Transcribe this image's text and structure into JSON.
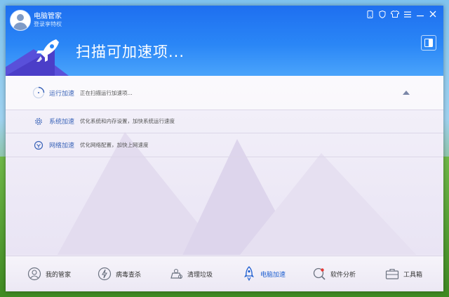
{
  "window": {
    "app_title": "电脑管家",
    "login_link": "登录享特权"
  },
  "header": {
    "scan_title": "扫描可加速项..."
  },
  "items": [
    {
      "label": "运行加速",
      "desc": "正在扫描运行加速项..."
    },
    {
      "label": "系统加速",
      "desc": "优化系统和内存设置，加快系统运行速度"
    },
    {
      "label": "网络加速",
      "desc": "优化网络配置，加快上网速度"
    }
  ],
  "nav": [
    {
      "label": "我的管家",
      "icon": "user-shield-icon"
    },
    {
      "label": "病毒查杀",
      "icon": "virus-scan-icon"
    },
    {
      "label": "清理垃圾",
      "icon": "trash-clean-icon"
    },
    {
      "label": "电脑加速",
      "icon": "rocket-icon"
    },
    {
      "label": "软件分析",
      "icon": "software-analysis-icon"
    },
    {
      "label": "工具箱",
      "icon": "toolbox-icon"
    }
  ],
  "colors": {
    "header_blue": "#1e6ff0",
    "accent_label": "#3a63b8",
    "active_nav": "#1e5fd0"
  }
}
